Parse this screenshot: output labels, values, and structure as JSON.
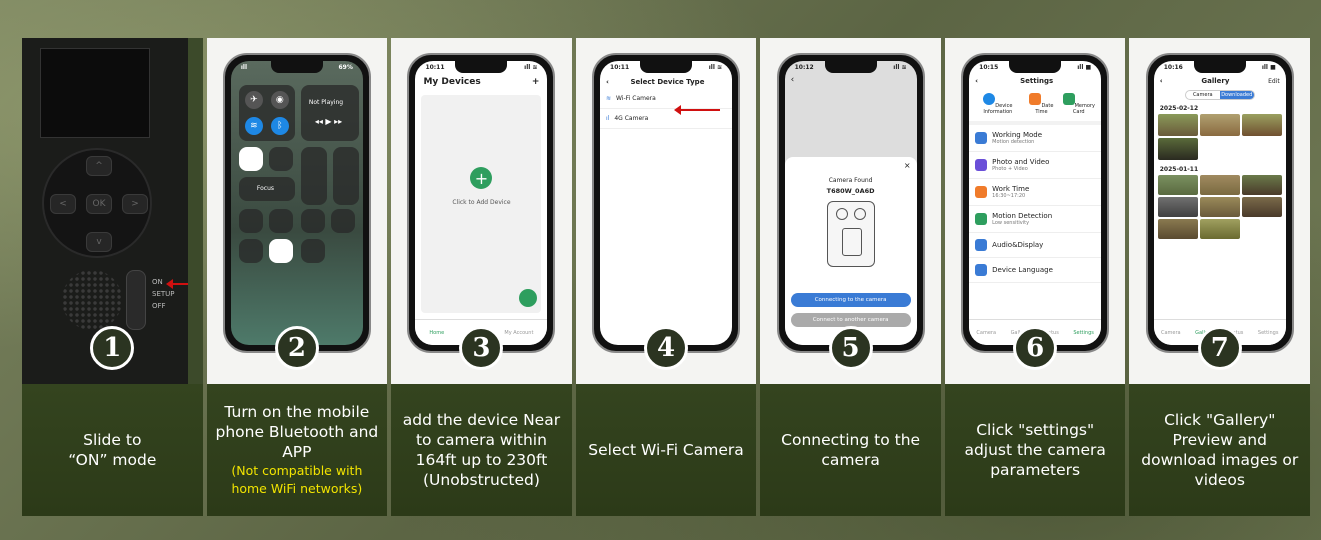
{
  "steps": [
    {
      "number": "1",
      "caption": "Slide to\n“ON” mode",
      "note": ""
    },
    {
      "number": "2",
      "caption": "Turn on the mobile phone Bluetooth and APP",
      "note": "(Not compatible with home WiFi networks)"
    },
    {
      "number": "3",
      "caption": "add the device Near to camera within 164ft up to 230ft (Unobstructed)",
      "note": ""
    },
    {
      "number": "4",
      "caption": "Select Wi-Fi Camera",
      "note": ""
    },
    {
      "number": "5",
      "caption": "Connecting to the camera",
      "note": ""
    },
    {
      "number": "6",
      "caption": "Click \"settings\" adjust the camera parameters",
      "note": ""
    },
    {
      "number": "7",
      "caption": "Click \"Gallery\" Preview and download images or videos",
      "note": ""
    }
  ],
  "camera": {
    "ok_label": "OK",
    "switch_labels": [
      "ON",
      "SETUP",
      "OFF"
    ]
  },
  "control_center": {
    "battery": "69%",
    "now_playing": "Not Playing",
    "focus_label": "Focus"
  },
  "my_devices": {
    "time": "10:11",
    "title": "My Devices",
    "add_symbol": "+",
    "center_label": "Click to Add Device",
    "tabs": [
      "Home",
      "",
      "My Account"
    ]
  },
  "select_device": {
    "time": "10:11",
    "title": "Select Device Type",
    "options": [
      "Wi-Fi Camera",
      "4G Camera"
    ]
  },
  "camera_found": {
    "time": "10:12",
    "heading": "Camera Found",
    "device_id": "T680W_0A6D",
    "primary_button": "Connecting to the camera",
    "secondary_button": "Connect to another camera"
  },
  "settings": {
    "time": "10:15",
    "title": "Settings",
    "top_items": [
      "Device Information",
      "Date Time",
      "Memory Card"
    ],
    "rows": [
      {
        "title": "Working Mode",
        "sub": "Motion detection"
      },
      {
        "title": "Photo and Video",
        "sub": "Photo + Video"
      },
      {
        "title": "Work Time",
        "sub": "16:30~17:20"
      },
      {
        "title": "Motion Detection",
        "sub": "Low sensitivity"
      },
      {
        "title": "Audio&Display",
        "sub": ""
      },
      {
        "title": "Device Language",
        "sub": ""
      }
    ],
    "tabs": [
      "Camera",
      "Gallery",
      "Status",
      "Settings"
    ]
  },
  "gallery": {
    "time": "10:16",
    "title": "Gallery",
    "edit": "Edit",
    "segments": [
      "Camera",
      "Downloaded"
    ],
    "dates": [
      "2025-02-12",
      "2025-01-11"
    ],
    "tabs": [
      "Camera",
      "Gallery",
      "Status",
      "Settings"
    ]
  },
  "colors": {
    "caption_bg": "#2f3d1c",
    "note_yellow": "#f2e400",
    "accent_green": "#2e9e5e",
    "accent_blue": "#3a7bd5",
    "arrow_red": "#d01010"
  }
}
